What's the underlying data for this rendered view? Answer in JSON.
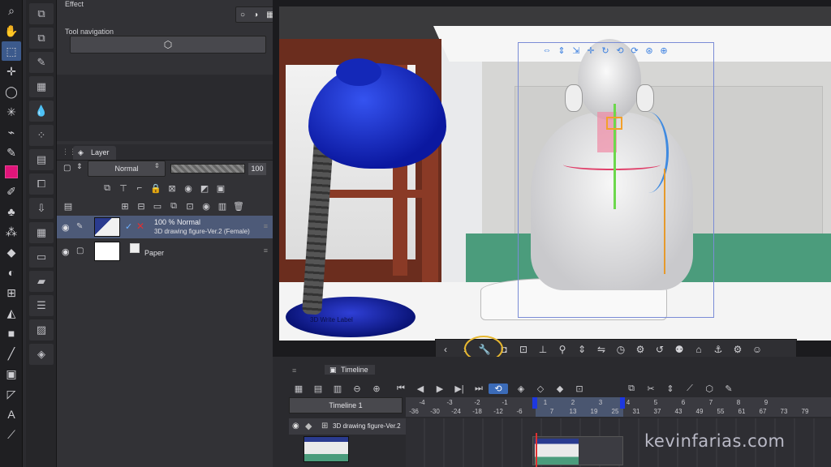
{
  "toolbar_left": {
    "tools": [
      "zoom-icon",
      "hand-icon",
      "object-select-icon",
      "move-icon",
      "lasso-icon",
      "magic-wand-icon",
      "eyedropper-icon",
      "pen-icon",
      "pink-swatch",
      "brush-icon",
      "fill-icon",
      "airbrush-icon",
      "eraser-icon",
      "blend-icon",
      "figure-icon",
      "bucket-icon",
      "gradient-icon",
      "line-icon",
      "frame-icon",
      "text-icon",
      "ruler-icon"
    ]
  },
  "panel": {
    "effect_label": "Effect",
    "tool_navigation_label": "Tool navigation",
    "layer_tab_label": "Layer",
    "blend_mode": "Normal",
    "opacity_value": "100",
    "layers": [
      {
        "line1": "100 %  Normal",
        "line2": "3D drawing figure-Ver.2 (Female)"
      },
      {
        "line1": "Paper",
        "line2": ""
      }
    ]
  },
  "canvas": {
    "lamp_text": "3D Write Label"
  },
  "timeline": {
    "tab_label": "Timeline",
    "select_label": "Timeline 1",
    "ruler_top": [
      "-4",
      "-3",
      "-2",
      "-1",
      "1",
      "2",
      "3",
      "4",
      "5",
      "6",
      "7",
      "8",
      "9"
    ],
    "ruler_bottom": [
      "-36",
      "-30",
      "-24",
      "-18",
      "-12",
      "-6",
      "7",
      "13",
      "19",
      "25",
      "31",
      "37",
      "43",
      "49",
      "55",
      "61",
      "67",
      "73",
      "79"
    ],
    "track_name": "3D drawing figure-Ver.2"
  },
  "watermark": "kevinfarias.com",
  "colors": {
    "accent_blue": "#3b6bb8",
    "selection": "#4d5a78",
    "highlight": "#e8b830",
    "lamp_blue": "#0b18a0",
    "pink": "#e0157a"
  }
}
